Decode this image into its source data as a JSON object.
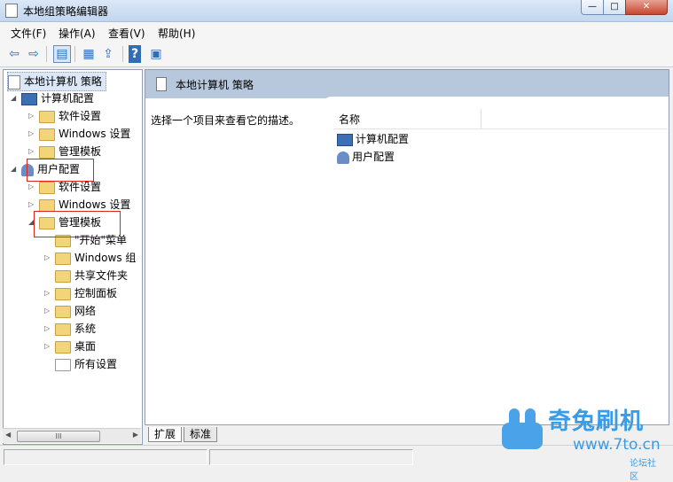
{
  "window": {
    "title": "本地组策略编辑器",
    "controls": {
      "minimize": "—",
      "maximize": "□",
      "close": "✕"
    }
  },
  "menu": [
    "文件(F)",
    "操作(A)",
    "查看(V)",
    "帮助(H)"
  ],
  "toolbar": {
    "icons": [
      "back-arrow-icon",
      "forward-arrow-icon",
      "show-hide-console-tree-icon",
      "properties-icon",
      "export-list-icon",
      "help-icon",
      "action-pane-icon"
    ],
    "glyphs": {
      "back": "⇦",
      "forward": "⇨",
      "tree": "▤",
      "props": "▦",
      "export": "⇪",
      "help": "?",
      "pane": "▣"
    }
  },
  "tree": {
    "root": "本地计算机 策略",
    "computer_config": {
      "label": "计算机配置",
      "children": [
        "软件设置",
        "Windows 设置",
        "管理模板"
      ]
    },
    "user_config": {
      "label": "用户配置",
      "children": [
        "软件设置",
        "Windows 设置",
        "管理模板"
      ],
      "admin_templates_children": [
        "\"开始\"菜单",
        "Windows 组",
        "共享文件夹",
        "控制面板",
        "网络",
        "系统",
        "桌面",
        "所有设置"
      ]
    },
    "arrow_expanded": "◢",
    "arrow_collapsed": "▷"
  },
  "scrollbar": {
    "left": "◀",
    "thumb": "III",
    "right": "▶"
  },
  "details": {
    "header_title": "本地计算机 策略",
    "description": "选择一个项目来查看它的描述。",
    "column_name": "名称",
    "items": [
      "计算机配置",
      "用户配置"
    ]
  },
  "tabs": [
    "扩展",
    "标准"
  ],
  "watermark": {
    "brand": "奇兔刷机",
    "url": "www.7to.cn",
    "sub": "论坛社区"
  },
  "colors": {
    "highlight_box": "#d9261c",
    "header_band": "#b7c8dc",
    "watermark": "#3a9be6"
  }
}
